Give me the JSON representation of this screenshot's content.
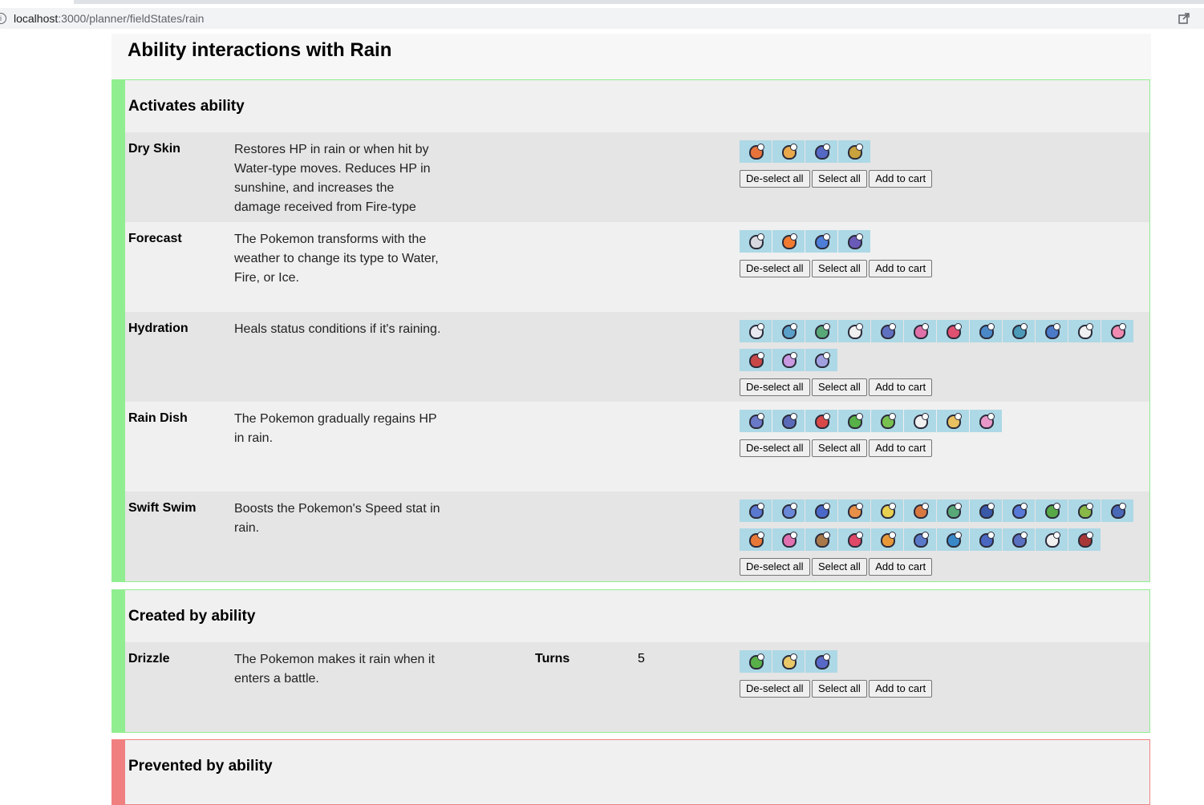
{
  "browser": {
    "url_host": "localhost",
    "url_path": ":3000/planner/fieldStates/rain"
  },
  "page": {
    "title": "Ability interactions with Rain"
  },
  "buttons": {
    "deselect": "De-select all",
    "select": "Select all",
    "cart": "Add to cart"
  },
  "sections": [
    {
      "title": "Activates ability",
      "accent": "#90ee90",
      "rows": [
        {
          "name": "Dry Skin",
          "description": "Restores HP in rain or when hit by Water-type moves. Reduces HP in sunshine, and increases the damage received from Fire-type",
          "sprites": [
            "#e8733a",
            "#e9a94b",
            "#5468c4",
            "#c8a23c"
          ]
        },
        {
          "name": "Forecast",
          "description": "The Pokemon transforms with the weather to change its type to Water, Fire, or Ice.",
          "sprites": [
            "#d8d8e0",
            "#f07a30",
            "#4e7fd8",
            "#6a5ab8"
          ]
        },
        {
          "name": "Hydration",
          "description": "Heals status conditions if it's raining.",
          "sprites": [
            "#e8e8f0",
            "#5aa0c8",
            "#58a878",
            "#f0f0f0",
            "#6070c0",
            "#e070a8",
            "#e05070",
            "#4a88c8",
            "#4a9ab8",
            "#4a7ac8",
            "#f0f0f0",
            "#f08ab0",
            "#c84848",
            "#c898e0",
            "#a0a0e0"
          ]
        },
        {
          "name": "Rain Dish",
          "description": "The Pokemon gradually regains HP in rain.",
          "sprites": [
            "#6a78c8",
            "#5a6ab8",
            "#d84848",
            "#58b048",
            "#78c050",
            "#f0f0f0",
            "#e8c060",
            "#e898c8"
          ]
        },
        {
          "name": "Swift Swim",
          "description": "Boosts the Pokemon's Speed stat in rain.",
          "sprites": [
            "#5a78d0",
            "#6a88d8",
            "#4a68c8",
            "#e89048",
            "#e8d050",
            "#d87840",
            "#58a878",
            "#3a58a8",
            "#5878d8",
            "#58a848",
            "#88b848",
            "#4a68b8",
            "#e87838",
            "#e070b0",
            "#a87848",
            "#e04868",
            "#e89838",
            "#5a78c8",
            "#3a88c8",
            "#4a68c0",
            "#5a70c0",
            "#f0f0f0",
            "#a83838"
          ]
        }
      ]
    },
    {
      "title": "Created by ability",
      "accent": "#90ee90",
      "rows": [
        {
          "name": "Drizzle",
          "description": "The Pokemon makes it rain when it enters a battle.",
          "key": "Turns",
          "value": "5",
          "sprites": [
            "#58b048",
            "#e8c868",
            "#5868c8"
          ]
        }
      ]
    },
    {
      "title": "Prevented by ability",
      "accent": "#f08080",
      "rows": []
    }
  ]
}
